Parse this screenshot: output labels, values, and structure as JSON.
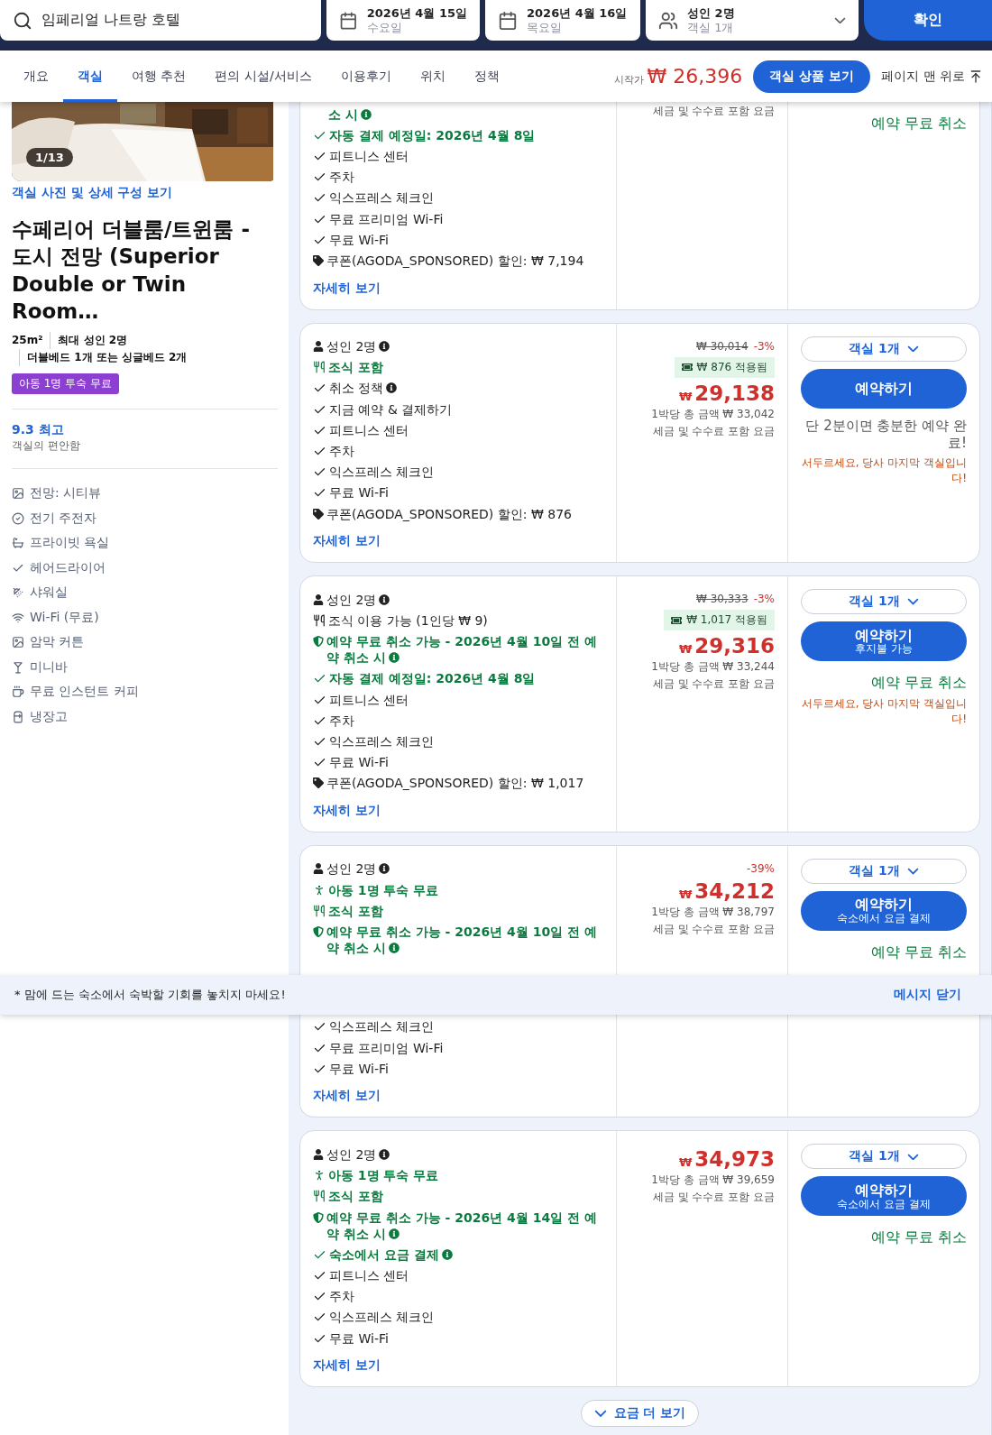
{
  "search": {
    "query": "임페리얼 나트랑 호텔",
    "check_in": {
      "date": "2026년 4월 15일",
      "weekday": "수요일"
    },
    "check_out": {
      "date": "2026년 4월 16일",
      "weekday": "목요일"
    },
    "guests": {
      "adults": "성인 2명",
      "rooms": "객실 1개"
    },
    "submit": "확인"
  },
  "nav": {
    "tabs": [
      {
        "label": "개요",
        "selected": false
      },
      {
        "label": "객실",
        "selected": true
      },
      {
        "label": "여행 추천",
        "selected": false
      },
      {
        "label": "편의 시설/서비스",
        "selected": false
      },
      {
        "label": "이용후기",
        "selected": false
      },
      {
        "label": "위치",
        "selected": false
      },
      {
        "label": "정책",
        "selected": false
      }
    ],
    "price_prefix": "시작가",
    "price_currency": "₩",
    "price": "26,396",
    "cta": "객실 상품 보기",
    "back_to_top": "페이지 맨 위로"
  },
  "room": {
    "photo_counter": "1/13",
    "photos_link": "객실 사진 및 상세 구성 보기",
    "title": "수페리어 더블룸/트윈룸 - 도시 전망 (Superior Double or Twin Room…",
    "specs": [
      "25m²",
      "최대 성인 2명",
      "더블베드 1개 또는 싱글베드 2개"
    ],
    "badge": "아동 1명 투숙 무료",
    "rating": "9.3 최고",
    "rating_label": "객실의 편안함",
    "amenities": [
      {
        "kind": "view",
        "label": "전망: 시티뷰"
      },
      {
        "kind": "badge",
        "label": "전기 주전자"
      },
      {
        "kind": "bath",
        "label": "프라이빗 욕실"
      },
      {
        "kind": "check",
        "label": "헤어드라이어"
      },
      {
        "kind": "shower",
        "label": "샤워실"
      },
      {
        "kind": "wifi",
        "label": "Wi-Fi (무료)"
      },
      {
        "kind": "view",
        "label": "암막 커튼"
      },
      {
        "kind": "bar",
        "label": "미니바"
      },
      {
        "kind": "coffee",
        "label": "무료 인스턴트 커피"
      },
      {
        "kind": "fridge",
        "label": "냉장고"
      }
    ]
  },
  "offers": [
    {
      "features": [
        {
          "kind": "continuation",
          "highlighted": true,
          "info": true,
          "text": "소 시"
        },
        {
          "kind": "check",
          "highlighted": true,
          "info": false,
          "text": "자동 결제 예정일: 2026년 4월 8일"
        },
        {
          "kind": "check",
          "highlighted": false,
          "info": false,
          "text": "피트니스 센터"
        },
        {
          "kind": "check",
          "highlighted": false,
          "info": false,
          "text": "주차"
        },
        {
          "kind": "check",
          "highlighted": false,
          "info": false,
          "text": "익스프레스 체크인"
        },
        {
          "kind": "check",
          "highlighted": false,
          "info": false,
          "text": "무료 프리미엄 Wi-Fi"
        },
        {
          "kind": "check",
          "highlighted": false,
          "info": false,
          "text": "무료 Wi-Fi"
        },
        {
          "kind": "coupon",
          "highlighted": false,
          "info": false,
          "text": "쿠폰(AGODA_SPONSORED) 할인: ₩ 7,194"
        }
      ],
      "details": "자세히 보기",
      "price": {
        "note": "세금 및 수수료 포함 요금"
      },
      "actions": {
        "free_cancel": "예약 무료 취소"
      }
    },
    {
      "features": [
        {
          "kind": "person",
          "highlighted": false,
          "info": true,
          "text": "성인 2명"
        },
        {
          "kind": "meal",
          "highlighted": true,
          "info": false,
          "text": "조식 포함"
        },
        {
          "kind": "check",
          "highlighted": false,
          "info": true,
          "text": "취소 정책"
        },
        {
          "kind": "check",
          "highlighted": false,
          "info": false,
          "text": "지금 예약 & 결제하기"
        },
        {
          "kind": "check",
          "highlighted": false,
          "info": false,
          "text": "피트니스 센터"
        },
        {
          "kind": "check",
          "highlighted": false,
          "info": false,
          "text": "주차"
        },
        {
          "kind": "check",
          "highlighted": false,
          "info": false,
          "text": "익스프레스 체크인"
        },
        {
          "kind": "check",
          "highlighted": false,
          "info": false,
          "text": "무료 Wi-Fi"
        },
        {
          "kind": "coupon",
          "highlighted": false,
          "info": false,
          "text": "쿠폰(AGODA_SPONSORED) 할인: ₩ 876"
        }
      ],
      "details": "자세히 보기",
      "price": {
        "original": "₩ 30,014",
        "discount": "-3%",
        "coupon_applied": "₩ 876 적용됨",
        "currency": "₩",
        "amount": "29,138",
        "total": "1박당 총 금액 ₩ 33,042",
        "note": "세금 및 수수료 포함 요금"
      },
      "actions": {
        "rooms": "객실 1개",
        "book": "예약하기",
        "urgency": "단 2분이면 충분한 예약 완료!",
        "warning": "서두르세요, 당사 마지막 객실입니다!"
      }
    },
    {
      "features": [
        {
          "kind": "person",
          "highlighted": false,
          "info": true,
          "text": "성인 2명"
        },
        {
          "kind": "meal",
          "highlighted": false,
          "info": false,
          "text": "조식 이용 가능 (1인당 ₩ 9)"
        },
        {
          "kind": "shield",
          "highlighted": true,
          "info": true,
          "text": "예약 무료 취소 가능 - 2026년 4월 10일 전 예약 취소 시"
        },
        {
          "kind": "check",
          "highlighted": true,
          "info": false,
          "text": "자동 결제 예정일: 2026년 4월 8일"
        },
        {
          "kind": "check",
          "highlighted": false,
          "info": false,
          "text": "피트니스 센터"
        },
        {
          "kind": "check",
          "highlighted": false,
          "info": false,
          "text": "주차"
        },
        {
          "kind": "check",
          "highlighted": false,
          "info": false,
          "text": "익스프레스 체크인"
        },
        {
          "kind": "check",
          "highlighted": false,
          "info": false,
          "text": "무료 Wi-Fi"
        },
        {
          "kind": "coupon",
          "highlighted": false,
          "info": false,
          "text": "쿠폰(AGODA_SPONSORED) 할인: ₩ 1,017"
        }
      ],
      "details": "자세히 보기",
      "price": {
        "original": "₩ 30,333",
        "discount": "-3%",
        "coupon_applied": "₩ 1,017 적용됨",
        "currency": "₩",
        "amount": "29,316",
        "total": "1박당 총 금액 ₩ 33,244",
        "note": "세금 및 수수료 포함 요금"
      },
      "actions": {
        "rooms": "객실 1개",
        "book": "예약하기",
        "book_sub": "후지불 가능",
        "free_cancel": "예약 무료 취소",
        "warning": "서두르세요, 당사 마지막 객실입니다!"
      }
    },
    {
      "features": [
        {
          "kind": "person",
          "highlighted": false,
          "info": true,
          "text": "성인 2명"
        },
        {
          "kind": "child",
          "highlighted": true,
          "info": false,
          "text": "아동 1명 투숙 무료"
        },
        {
          "kind": "meal",
          "highlighted": true,
          "info": false,
          "text": "조식 포함"
        },
        {
          "kind": "shield",
          "highlighted": true,
          "info": true,
          "text": "예약 무료 취소 가능 - 2026년 4월 10일 전 예약 취소 시"
        }
      ],
      "features_below_notice": [
        {
          "kind": "check",
          "highlighted": false,
          "info": false,
          "text": "익스프레스 체크인"
        },
        {
          "kind": "check",
          "highlighted": false,
          "info": false,
          "text": "무료 프리미엄 Wi-Fi"
        },
        {
          "kind": "check",
          "highlighted": false,
          "info": false,
          "text": "무료 Wi-Fi"
        }
      ],
      "details": "자세히 보기",
      "price": {
        "discount": "-39%",
        "currency": "₩",
        "amount": "34,212",
        "total": "1박당 총 금액 ₩ 38,797",
        "note": "세금 및 수수료 포함 요금"
      },
      "actions": {
        "rooms": "객실 1개",
        "book": "예약하기",
        "book_sub": "숙소에서 요금 결제",
        "free_cancel": "예약 무료 취소"
      }
    },
    {
      "features": [
        {
          "kind": "person",
          "highlighted": false,
          "info": true,
          "text": "성인 2명"
        },
        {
          "kind": "child",
          "highlighted": true,
          "info": false,
          "text": "아동 1명 투숙 무료"
        },
        {
          "kind": "meal",
          "highlighted": true,
          "info": false,
          "text": "조식 포함"
        },
        {
          "kind": "shield",
          "highlighted": true,
          "info": true,
          "text": "예약 무료 취소 가능 - 2026년 4월 14일 전 예약 취소 시"
        },
        {
          "kind": "check",
          "highlighted": true,
          "info": true,
          "text": "숙소에서 요금 결제"
        },
        {
          "kind": "check",
          "highlighted": false,
          "info": false,
          "text": "피트니스 센터"
        },
        {
          "kind": "check",
          "highlighted": false,
          "info": false,
          "text": "주차"
        },
        {
          "kind": "check",
          "highlighted": false,
          "info": false,
          "text": "익스프레스 체크인"
        },
        {
          "kind": "check",
          "highlighted": false,
          "info": false,
          "text": "무료 Wi-Fi"
        }
      ],
      "details": "자세히 보기",
      "price": {
        "currency": "₩",
        "amount": "34,973",
        "total": "1박당 총 금액 ₩ 39,659",
        "note": "세금 및 수수료 포함 요금"
      },
      "actions": {
        "rooms": "객실 1개",
        "book": "예약하기",
        "book_sub": "숙소에서 요금 결제",
        "free_cancel": "예약 무료 취소"
      }
    }
  ],
  "notice": {
    "text": "* 맘에 드는 숙소에서 숙박할 기회를 놓치지 마세요!",
    "close": "메시지 닫기"
  },
  "more_rates": "요금 더 보기"
}
